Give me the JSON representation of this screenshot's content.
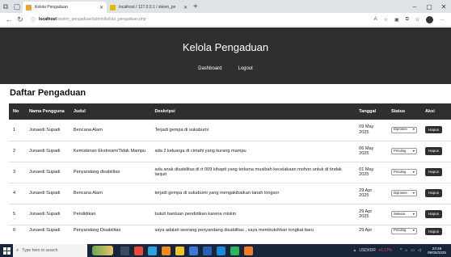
{
  "browser": {
    "tabs": [
      {
        "label": "Kelola Pengaduan",
        "favicon_color": "#e8a23c"
      },
      {
        "label": "localhost / 127.0.0.1 / sikom_pe",
        "favicon_color": "#e6b800"
      }
    ],
    "url_host": "localhost",
    "url_path": "/sistem_pengaduan/admin/kelola_pengaduan.php"
  },
  "header": {
    "title": "Kelola Pengaduan",
    "menu": [
      "Dashboard",
      "Logout"
    ],
    "bg_color": "#2f2f2f"
  },
  "section_title": "Daftar Pengaduan",
  "table": {
    "columns": [
      "No",
      "Nama Pengguna",
      "Judul",
      "Deskripsi",
      "Tanggal",
      "Status",
      "Aksi"
    ],
    "action_label": "Hapus",
    "rows": [
      {
        "no": "1",
        "nama": "Junaedi Supadi",
        "judul": "Bencana Alam",
        "deskripsi": "Terjadi gempa di sukabumi",
        "tanggal": "09 May 2025",
        "status": "Diproses"
      },
      {
        "no": "2",
        "nama": "Junaedi Supadi",
        "judul": "Kemiskinan Ekstream/Tidak Mampu",
        "deskripsi": "ada 2 keluarga di cimahi yang kurang mampu",
        "tanggal": "06 May 2025",
        "status": "Pending"
      },
      {
        "no": "3",
        "nama": "Junaedi Supadi",
        "judul": "Penyandang disabilitas",
        "deskripsi": "ada anak disabilitas di rt 009 kihapit yang terkena musibah kecelakaan mohon untuk di tindak lanjuti",
        "tanggal": "01 May 2025",
        "status": "Pending"
      },
      {
        "no": "4",
        "nama": "Junaedi Supadi",
        "judul": "Bencana Alam",
        "deskripsi": "terjadi gempa di sukabumi yang mengakibatkan tanah longsor",
        "tanggal": "29 Apr 2025",
        "status": "Diproses"
      },
      {
        "no": "5",
        "nama": "Junaedi Supadi",
        "judul": "Pendidikan",
        "deskripsi": "butuh bantuan pendidikan karena miskin",
        "tanggal": "29 Apr 2025",
        "status": "Selesai"
      },
      {
        "no": "6",
        "nama": "Junaedi Supadi",
        "judul": "Penyandang Disabilitas",
        "deskripsi": "saya adalah seorang penyandang disabilitas , saya membutuhkan tongkat baru",
        "tanggal": "29 Apr",
        "status": "Pending"
      }
    ]
  },
  "taskbar": {
    "search_placeholder": "Type here to search",
    "weather_label": "USD/IDR",
    "weather_change": "+0.17%",
    "time": "23:48",
    "date": "09/05/2025"
  }
}
